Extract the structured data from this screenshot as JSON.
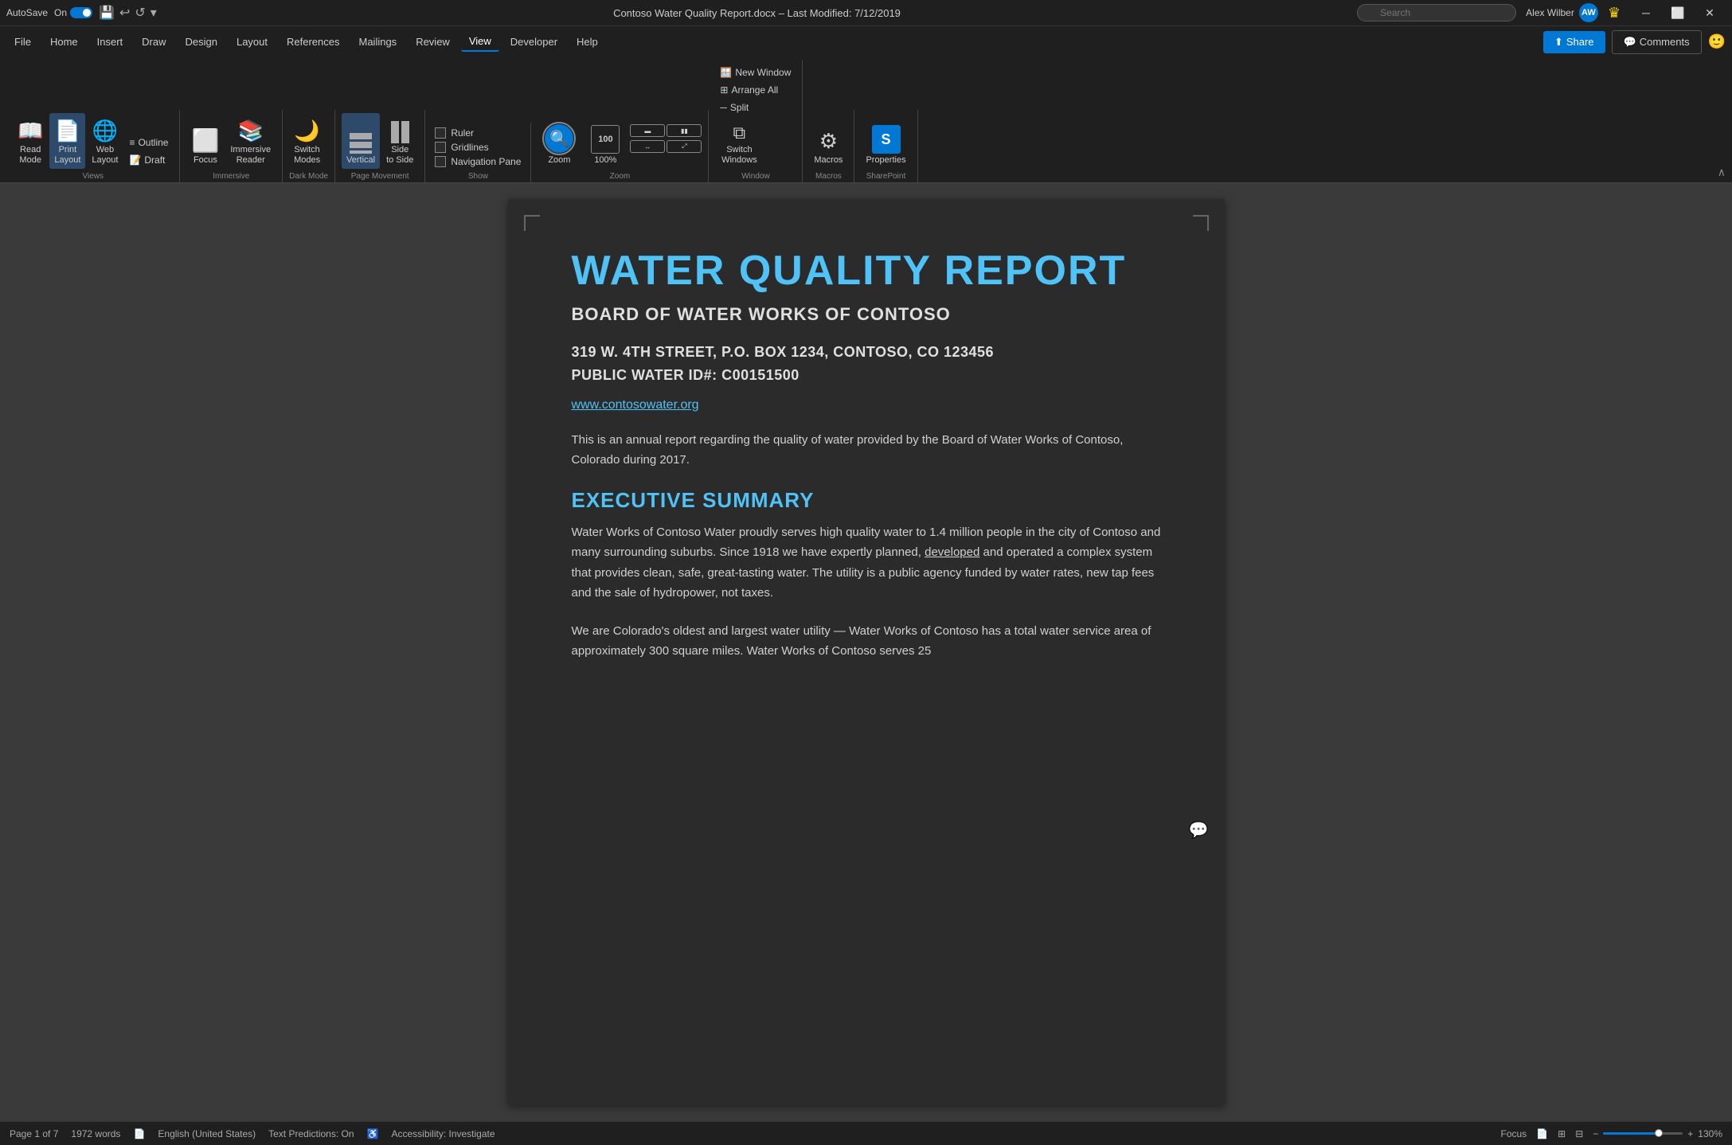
{
  "titlebar": {
    "autosave_label": "AutoSave",
    "autosave_state": "On",
    "filename": "Contoso Water Quality Report.docx",
    "modified_label": "Last Modified: 7/12/2019",
    "user_name": "Alex Wilber",
    "user_initials": "AW",
    "search_placeholder": "Search"
  },
  "menubar": {
    "items": [
      "File",
      "Home",
      "Insert",
      "Draw",
      "Design",
      "Layout",
      "References",
      "Mailings",
      "Review",
      "View",
      "Developer",
      "Help"
    ]
  },
  "ribbon": {
    "active_tab": "View",
    "groups": [
      {
        "name": "Views",
        "label": "Views",
        "buttons": [
          {
            "id": "read-mode",
            "label": "Read\nMode",
            "icon": "📖",
            "active": false
          },
          {
            "id": "print-layout",
            "label": "Print\nLayout",
            "icon": "📄",
            "active": true
          },
          {
            "id": "web-layout",
            "label": "Web\nLayout",
            "icon": "🌐",
            "active": false
          }
        ],
        "small_buttons": [
          {
            "id": "outline",
            "label": "Outline"
          },
          {
            "id": "draft",
            "label": "Draft"
          }
        ]
      },
      {
        "name": "Immersive",
        "label": "Immersive",
        "buttons": [
          {
            "id": "focus",
            "label": "Focus",
            "icon": "◻",
            "active": false
          },
          {
            "id": "immersive-reader",
            "label": "Immersive\nReader",
            "icon": "📚",
            "active": false
          }
        ]
      },
      {
        "name": "Dark Mode",
        "label": "Dark Mode",
        "buttons": [
          {
            "id": "switch-modes",
            "label": "Switch\nModes",
            "icon": "🌙",
            "active": false
          }
        ]
      },
      {
        "name": "Page Movement",
        "label": "Page Movement",
        "buttons": [
          {
            "id": "vertical",
            "label": "Vertical",
            "icon": "↕",
            "active": true
          },
          {
            "id": "side-to-side",
            "label": "Side\nto Side",
            "icon": "↔",
            "active": false
          }
        ]
      },
      {
        "name": "Show",
        "label": "Show",
        "checkboxes": [
          {
            "id": "ruler",
            "label": "Ruler",
            "checked": false
          },
          {
            "id": "gridlines",
            "label": "Gridlines",
            "checked": false
          },
          {
            "id": "navigation-pane",
            "label": "Navigation Pane",
            "checked": false
          }
        ]
      },
      {
        "name": "Zoom",
        "label": "Zoom",
        "zoom_value": "100%",
        "buttons": [
          {
            "id": "zoom-btn",
            "label": "",
            "icon": "🔍"
          },
          {
            "id": "zoom-100",
            "label": "100%"
          },
          {
            "id": "zoom-grid"
          }
        ]
      },
      {
        "name": "Window",
        "label": "Window",
        "buttons": [
          {
            "id": "new-window",
            "label": "New Window"
          },
          {
            "id": "arrange-all",
            "label": "Arrange All"
          },
          {
            "id": "split",
            "label": "Split"
          },
          {
            "id": "switch-windows",
            "label": "Switch\nWindows"
          }
        ]
      },
      {
        "name": "Macros",
        "label": "Macros",
        "buttons": [
          {
            "id": "macros",
            "label": "Macros",
            "icon": "⚙"
          }
        ]
      },
      {
        "name": "SharePoint",
        "label": "SharePoint",
        "buttons": [
          {
            "id": "properties",
            "label": "Properties",
            "icon": "S"
          }
        ]
      }
    ],
    "share_label": "Share",
    "comments_label": "Comments"
  },
  "document": {
    "title": "WATER QUALITY REPORT",
    "subtitle": "BOARD OF WATER WORKS OF CONTOSO",
    "address_line1": "319 W. 4TH STREET, P.O. BOX 1234, CONTOSO, CO 123456",
    "address_line2": "PUBLIC WATER ID#: C00151500",
    "website": "www.contosowater.org",
    "intro": "This is an annual report regarding the quality of water provided by the Board of Water Works of Contoso, Colorado during 2017.",
    "exec_summary_title": "EXECUTIVE SUMMARY",
    "exec_summary_p1": "Water Works of Contoso Water proudly serves high quality water to 1.4 million people in the city of Contoso and many surrounding suburbs. Since 1918 we have expertly planned, developed and operated a complex system that provides clean, safe, great-tasting water. The utility is a public agency funded by water rates, new tap fees and the sale of hydropower, not taxes.",
    "exec_summary_p2": "We are Colorado's oldest and largest water utility — Water Works of Contoso has a total water service area of approximately 300 square miles. Water Works of Contoso serves 25"
  },
  "statusbar": {
    "page": "Page 1 of 7",
    "words": "1972 words",
    "language": "English (United States)",
    "text_predictions": "Text Predictions: On",
    "accessibility": "Accessibility: Investigate",
    "focus_label": "Focus",
    "zoom_value": "130%"
  }
}
